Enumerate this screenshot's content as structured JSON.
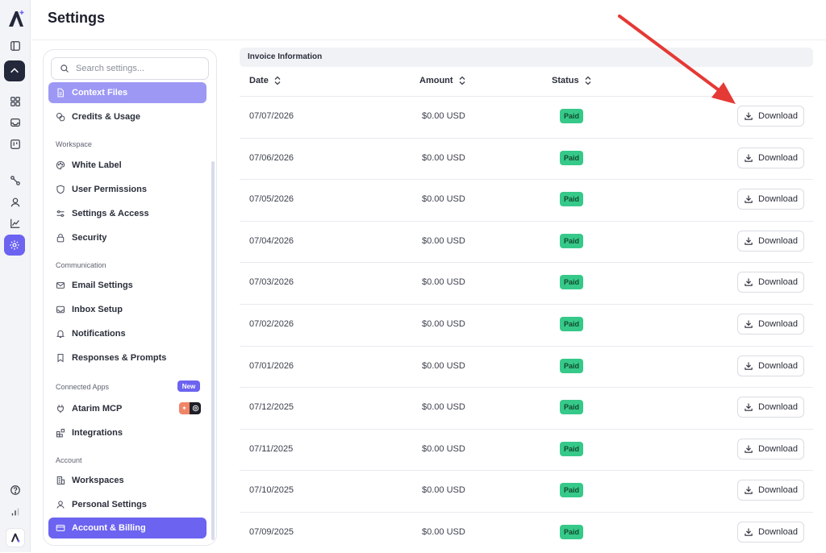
{
  "header": {
    "title": "Settings"
  },
  "rail": {
    "icons": [
      "atarim-logo",
      "sidebar-toggle-icon",
      "atarim-mark-icon",
      "grid-icon",
      "inbox-icon",
      "board-icon",
      "workflow-icon",
      "user-icon",
      "chart-icon",
      "settings-icon",
      "help-icon",
      "bars-icon",
      "atarim-small-logo"
    ]
  },
  "search": {
    "placeholder": "Search settings..."
  },
  "nav": {
    "context_files": "Context Files",
    "credits_usage": "Credits & Usage",
    "workspace_label": "Workspace",
    "white_label": "White Label",
    "user_permissions": "User Permissions",
    "settings_access": "Settings & Access",
    "security": "Security",
    "communication_label": "Communication",
    "email_settings": "Email Settings",
    "inbox_setup": "Inbox Setup",
    "notifications": "Notifications",
    "responses_prompts": "Responses & Prompts",
    "connected_apps_label": "Connected Apps",
    "new_badge": "New",
    "atarim_mcp": "Atarim MCP",
    "integrations": "Integrations",
    "account_label": "Account",
    "workspaces": "Workspaces",
    "personal_settings": "Personal Settings",
    "account_billing": "Account & Billing"
  },
  "invoices": {
    "section_title": "Invoice Information",
    "columns": {
      "date": "Date",
      "amount": "Amount",
      "status": "Status"
    },
    "download_label": "Download",
    "rows": [
      {
        "date": "07/07/2026",
        "amount": "$0.00 USD",
        "status": "Paid"
      },
      {
        "date": "07/06/2026",
        "amount": "$0.00 USD",
        "status": "Paid"
      },
      {
        "date": "07/05/2026",
        "amount": "$0.00 USD",
        "status": "Paid"
      },
      {
        "date": "07/04/2026",
        "amount": "$0.00 USD",
        "status": "Paid"
      },
      {
        "date": "07/03/2026",
        "amount": "$0.00 USD",
        "status": "Paid"
      },
      {
        "date": "07/02/2026",
        "amount": "$0.00 USD",
        "status": "Paid"
      },
      {
        "date": "07/01/2026",
        "amount": "$0.00 USD",
        "status": "Paid"
      },
      {
        "date": "07/12/2025",
        "amount": "$0.00 USD",
        "status": "Paid"
      },
      {
        "date": "07/11/2025",
        "amount": "$0.00 USD",
        "status": "Paid"
      },
      {
        "date": "07/10/2025",
        "amount": "$0.00 USD",
        "status": "Paid"
      },
      {
        "date": "07/09/2025",
        "amount": "$0.00 USD",
        "status": "Paid"
      }
    ]
  },
  "colors": {
    "accent": "#6c63f0",
    "accent_light": "#9e98f5",
    "paid": "#36c98a",
    "annotation_arrow": "#e53935"
  }
}
